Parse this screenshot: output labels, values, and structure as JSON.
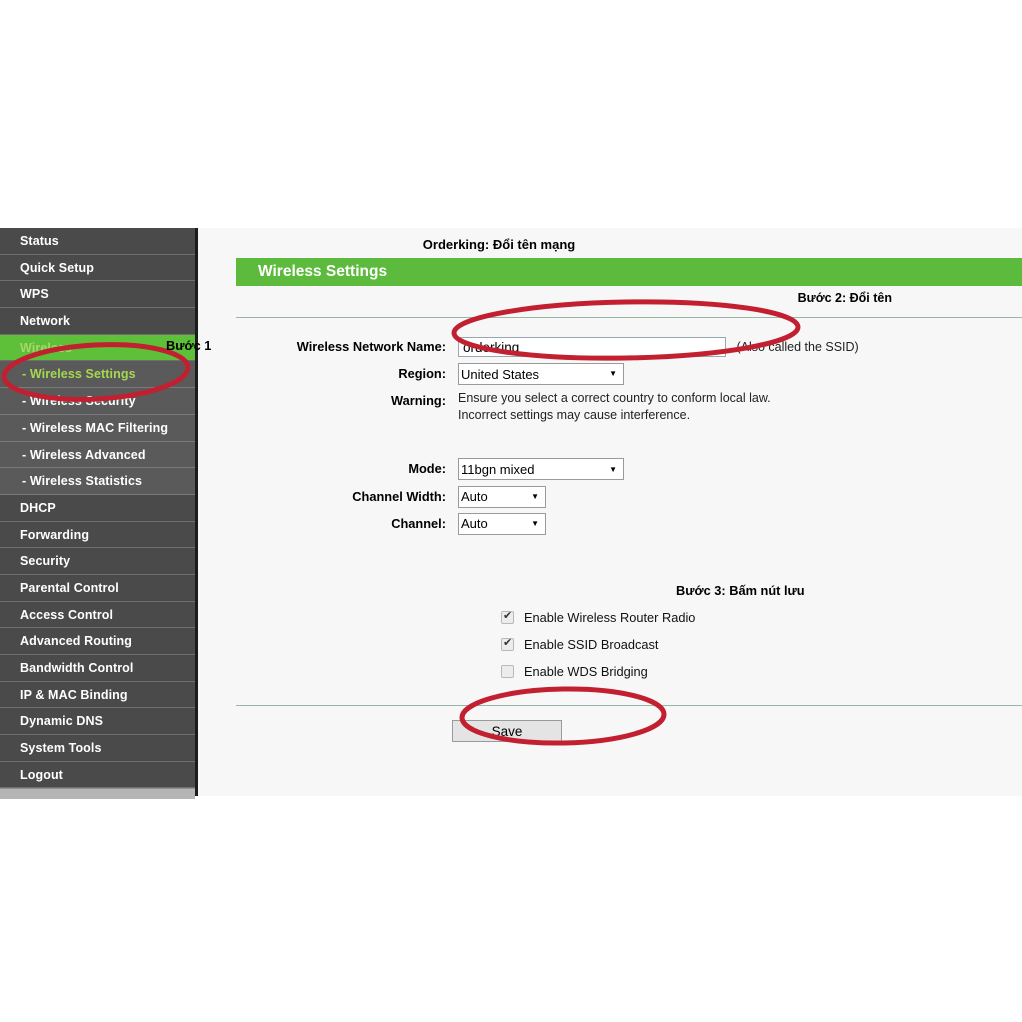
{
  "sidebar": {
    "items": [
      {
        "label": "Status",
        "type": "main",
        "state": "normal"
      },
      {
        "label": "Quick Setup",
        "type": "main",
        "state": "normal"
      },
      {
        "label": "WPS",
        "type": "main",
        "state": "normal"
      },
      {
        "label": "Network",
        "type": "main",
        "state": "normal"
      },
      {
        "label": "Wireless",
        "type": "main",
        "state": "active"
      },
      {
        "label": "- Wireless Settings",
        "type": "sub",
        "state": "active-sub"
      },
      {
        "label": "- Wireless Security",
        "type": "sub",
        "state": "normal"
      },
      {
        "label": "- Wireless MAC Filtering",
        "type": "sub",
        "state": "normal"
      },
      {
        "label": "- Wireless Advanced",
        "type": "sub",
        "state": "normal"
      },
      {
        "label": "- Wireless Statistics",
        "type": "sub",
        "state": "normal"
      },
      {
        "label": "DHCP",
        "type": "main",
        "state": "normal"
      },
      {
        "label": "Forwarding",
        "type": "main",
        "state": "normal"
      },
      {
        "label": "Security",
        "type": "main",
        "state": "normal"
      },
      {
        "label": "Parental Control",
        "type": "main",
        "state": "normal"
      },
      {
        "label": "Access Control",
        "type": "main",
        "state": "normal"
      },
      {
        "label": "Advanced Routing",
        "type": "main",
        "state": "normal"
      },
      {
        "label": "Bandwidth Control",
        "type": "main",
        "state": "normal"
      },
      {
        "label": "IP & MAC Binding",
        "type": "main",
        "state": "normal"
      },
      {
        "label": "Dynamic DNS",
        "type": "main",
        "state": "normal"
      },
      {
        "label": "System Tools",
        "type": "main",
        "state": "normal"
      },
      {
        "label": "Logout",
        "type": "main",
        "state": "normal"
      }
    ]
  },
  "content": {
    "subtitle": "Orderking: Đổi tên mạng",
    "section_title": "Wireless Settings",
    "form": {
      "ssid_label": "Wireless Network Name:",
      "ssid_value": "orderking",
      "ssid_placeholder": "",
      "ssid_hint": "(Also called the SSID)",
      "region_label": "Region:",
      "region_value": "United States",
      "region_options": [
        "United States"
      ],
      "warning_label": "Warning:",
      "warning_line1": "Ensure you select a correct country to conform local law.",
      "warning_line2": "Incorrect settings may cause interference.",
      "mode_label": "Mode:",
      "mode_value": "11bgn mixed",
      "mode_options": [
        "11bgn mixed"
      ],
      "channel_width_label": "Channel Width:",
      "channel_width_value": "Auto",
      "channel_width_options": [
        "Auto"
      ],
      "channel_label": "Channel:",
      "channel_value": "Auto",
      "channel_options": [
        "Auto"
      ]
    },
    "checkboxes": [
      {
        "label": "Enable Wireless Router Radio",
        "checked": true
      },
      {
        "label": "Enable SSID Broadcast",
        "checked": true
      },
      {
        "label": "Enable WDS Bridging",
        "checked": false
      }
    ],
    "save_label": "Save"
  },
  "annotations": {
    "step1": "Bước 1",
    "step2": "Bước 2: Đổi tên",
    "step3": "Bước 3: Bấm nút lưu",
    "highlight_color": "#c22030"
  }
}
